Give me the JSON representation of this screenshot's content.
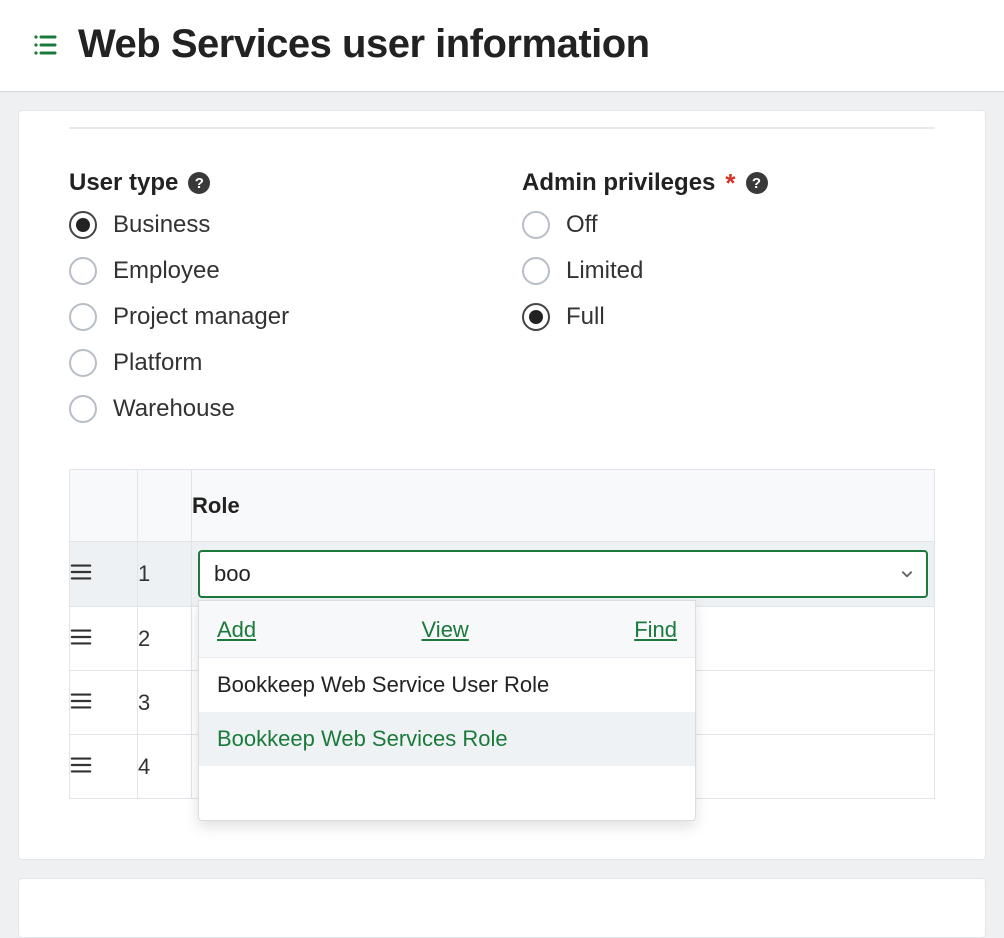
{
  "header": {
    "title": "Web Services user information"
  },
  "userType": {
    "label": "User type",
    "options": [
      {
        "label": "Business",
        "selected": true
      },
      {
        "label": "Employee",
        "selected": false
      },
      {
        "label": "Project manager",
        "selected": false
      },
      {
        "label": "Platform",
        "selected": false
      },
      {
        "label": "Warehouse",
        "selected": false
      }
    ]
  },
  "adminPrivileges": {
    "label": "Admin privileges",
    "required": true,
    "options": [
      {
        "label": "Off",
        "selected": false
      },
      {
        "label": "Limited",
        "selected": false
      },
      {
        "label": "Full",
        "selected": true
      }
    ]
  },
  "rolesTable": {
    "columnHeader": "Role",
    "rows": [
      {
        "num": "1"
      },
      {
        "num": "2"
      },
      {
        "num": "3"
      },
      {
        "num": "4"
      }
    ]
  },
  "roleCombo": {
    "value": "boo",
    "actions": {
      "add": "Add",
      "view": "View",
      "find": "Find"
    },
    "suggestions": [
      {
        "label": "Bookkeep Web Service User Role",
        "highlighted": false
      },
      {
        "label": "Bookkeep Web Services Role",
        "highlighted": true
      }
    ]
  }
}
